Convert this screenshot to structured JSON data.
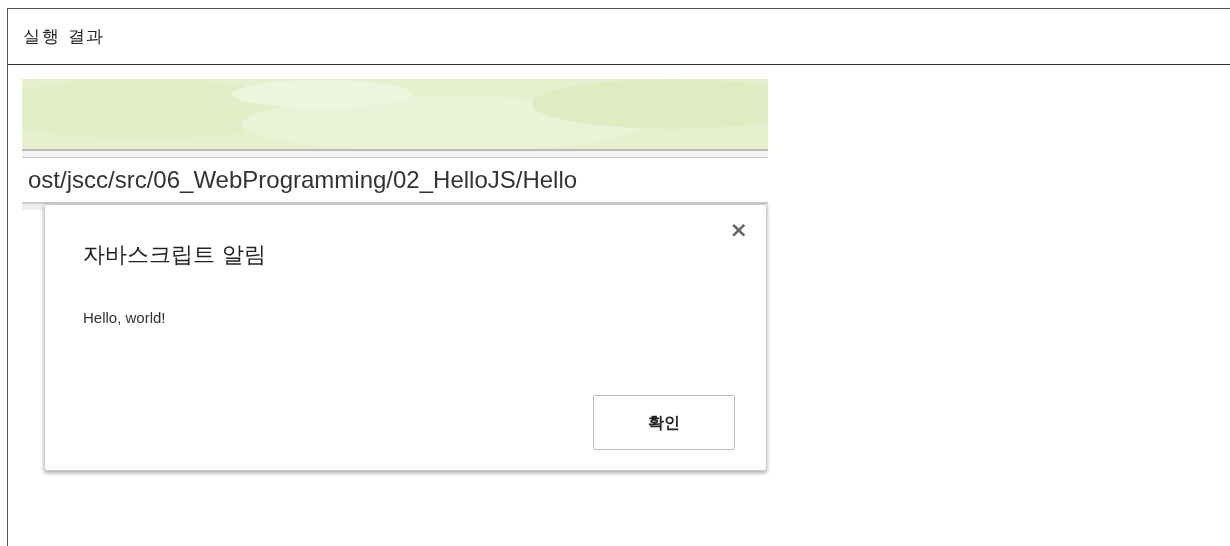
{
  "panel": {
    "title": "실행 결과"
  },
  "browser": {
    "address": "ost/jscc/src/06_WebProgramming/02_HelloJS/Hello"
  },
  "dialog": {
    "title": "자바스크립트 알림",
    "close": "×",
    "message": "Hello, world!",
    "buttons": [
      "확인"
    ]
  }
}
